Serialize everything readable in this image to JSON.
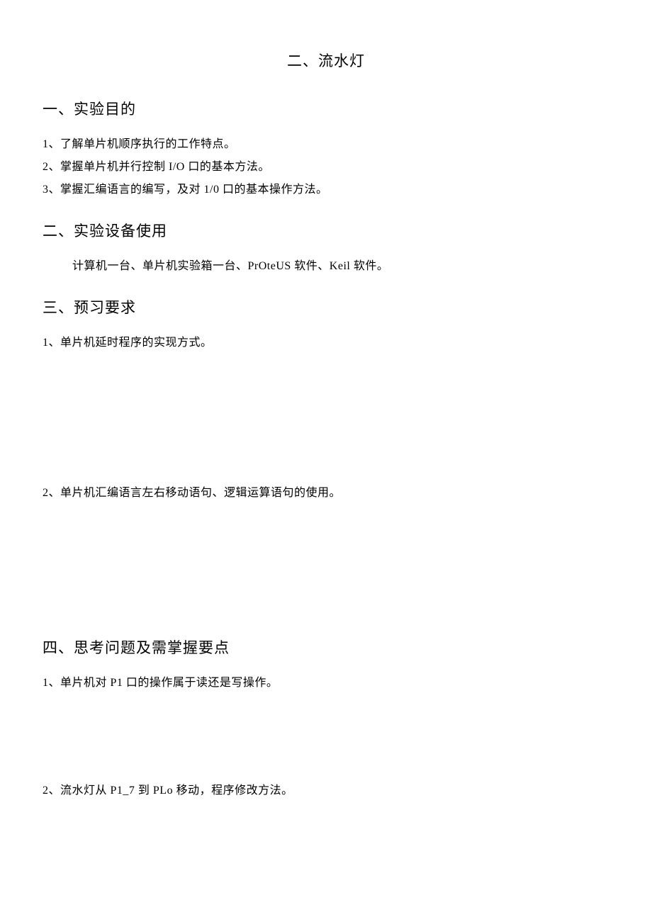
{
  "title": "二、流水灯",
  "section1": {
    "heading": "一、实验目的",
    "items": [
      "1、了解单片机顺序执行的工作特点。",
      "2、掌握单片机并行控制 I/O 口的基本方法。",
      "3、掌握汇编语言的编写，及对 1/0 口的基本操作方法。"
    ]
  },
  "section2": {
    "heading": "二、实验设备使用",
    "body": "计算机一台、单片机实验箱一台、PrOteUS 软件、Keil 软件。"
  },
  "section3": {
    "heading": "三、预习要求",
    "items": [
      "1、单片机延时程序的实现方式。",
      "2、单片机汇编语言左右移动语句、逻辑运算语句的使用。"
    ]
  },
  "section4": {
    "heading": "四、思考问题及需掌握要点",
    "items": [
      "1、单片机对 P1 口的操作属于读还是写操作。",
      "2、流水灯从 P1_7 到 PLo 移动，程序修改方法。"
    ]
  }
}
